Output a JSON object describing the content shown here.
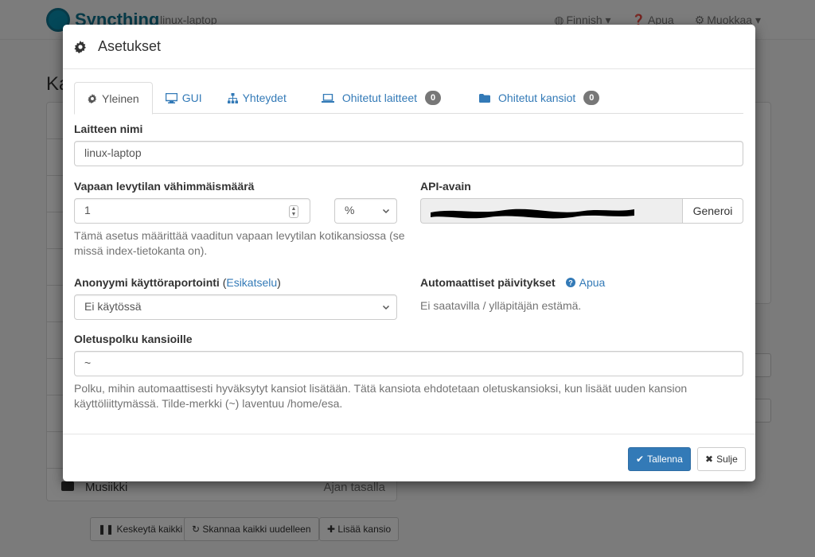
{
  "navbar": {
    "brand": "Syncthing",
    "device": "linux-laptop",
    "language": "Finnish",
    "help": "Apua",
    "actions": "Muokkaa"
  },
  "background": {
    "heading": "Ka",
    "last_folder_name": "Musiikki",
    "last_folder_status": "Ajan tasalla",
    "buttons": {
      "pause_all": "Keskeytä kaikki",
      "rescan_all": "Skannaa kaikki uudelleen",
      "add_folder": "Lisää kansio"
    }
  },
  "modal": {
    "title": "Asetukset",
    "tabs": [
      {
        "label": "Yleinen",
        "icon": "gear-icon",
        "active": true
      },
      {
        "label": "GUI",
        "icon": "desktop-icon"
      },
      {
        "label": "Yhteydet",
        "icon": "sitemap-icon"
      },
      {
        "label": "Ohitetut laitteet",
        "icon": "laptop-icon",
        "badge": "0"
      },
      {
        "label": "Ohitetut kansiot",
        "icon": "folder-icon",
        "badge": "0"
      }
    ],
    "device_name": {
      "label": "Laitteen nimi",
      "value": "linux-laptop"
    },
    "min_disk_free": {
      "label": "Vapaan levytilan vähimmäismäärä",
      "value": "1",
      "unit": "%",
      "help": "Tämä asetus määrittää vaaditun vapaan levytilan kotikansiossa (se missä index-tietokanta on)."
    },
    "api_key": {
      "label": "API-avain",
      "generate": "Generoi"
    },
    "usage_reporting": {
      "label": "Anonyymi käyttöraportointi",
      "preview_link": "Esikatselu",
      "value": "Ei käytössä"
    },
    "auto_upgrades": {
      "label": "Automaattiset päivitykset",
      "help_link": "Apua",
      "status": "Ei saatavilla / ylläpitäjän estämä."
    },
    "default_folder_path": {
      "label": "Oletuspolku kansioille",
      "value": "~",
      "help": "Polku, mihin automaattisesti hyväksytyt kansiot lisätään. Tätä kansiota ehdotetaan oletuskansioksi, kun lisäät uuden kansion käyttöliittymässä. Tilde-merkki (~) laventuu /home/esa."
    },
    "footer": {
      "save": "Tallenna",
      "close": "Sulje"
    }
  },
  "colors": {
    "primary": "#337ab7",
    "brand": "#0e7490",
    "badge": "#777777"
  }
}
